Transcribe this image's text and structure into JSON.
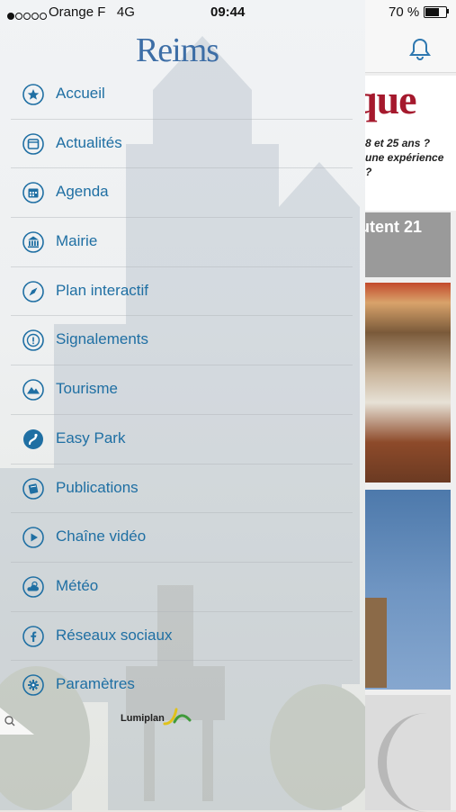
{
  "status_bar": {
    "carrier": "Orange F",
    "network": "4G",
    "time": "09:44",
    "battery_percent": "70 %",
    "battery_level": 0.7
  },
  "drawer": {
    "logo": "Reims",
    "menu": [
      {
        "label": "Accueil",
        "icon": "star-icon"
      },
      {
        "label": "Actualités",
        "icon": "news-icon"
      },
      {
        "label": "Agenda",
        "icon": "calendar-icon"
      },
      {
        "label": "Mairie",
        "icon": "town-hall-icon"
      },
      {
        "label": "Plan interactif",
        "icon": "compass-icon"
      },
      {
        "label": "Signalements",
        "icon": "alert-icon"
      },
      {
        "label": "Tourisme",
        "icon": "mountain-icon"
      },
      {
        "label": "Easy Park",
        "icon": "parking-route-icon"
      },
      {
        "label": "Publications",
        "icon": "book-icon"
      },
      {
        "label": "Chaîne vidéo",
        "icon": "play-icon"
      },
      {
        "label": "Météo",
        "icon": "weather-icon"
      },
      {
        "label": "Réseaux sociaux",
        "icon": "facebook-icon"
      },
      {
        "label": "Paramètres",
        "icon": "gear-icon"
      }
    ],
    "footer_brand": "Lumiplan"
  },
  "background": {
    "headline_big": "que",
    "headline_line1": "8 et 25 ans ?",
    "headline_line2": "une expérience",
    "headline_line3": "?",
    "card_title": "utent 21"
  },
  "colors": {
    "accent": "#1f6fa3",
    "logo": "#3d6ea6",
    "headline": "#a5192d"
  }
}
